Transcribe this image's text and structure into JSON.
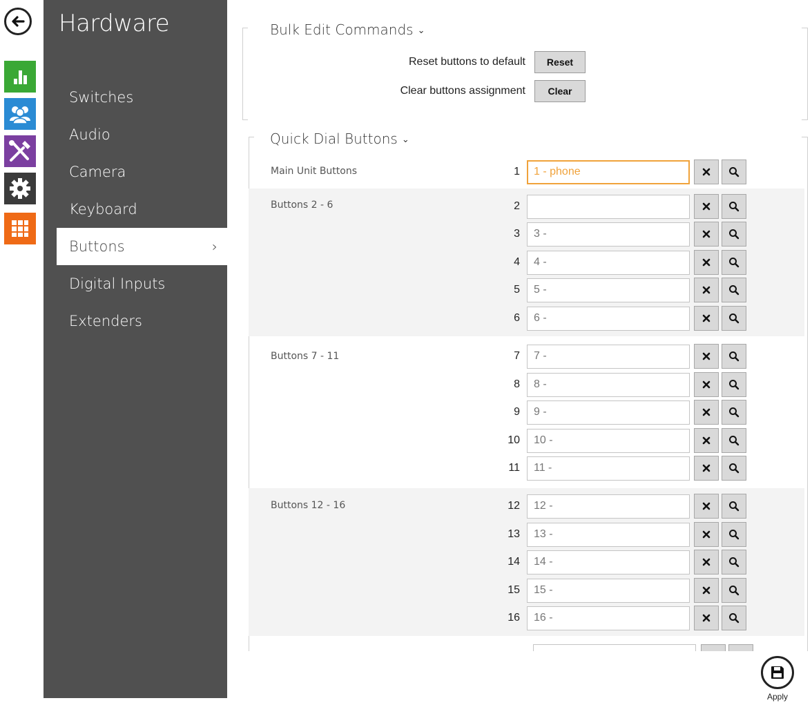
{
  "sidebar": {
    "title": "Hardware",
    "items": [
      {
        "label": "Switches"
      },
      {
        "label": "Audio"
      },
      {
        "label": "Camera"
      },
      {
        "label": "Keyboard"
      },
      {
        "label": "Buttons",
        "chevron": "›"
      },
      {
        "label": "Digital Inputs"
      },
      {
        "label": "Extenders"
      }
    ]
  },
  "rail_icons": [
    {
      "name": "status-icon",
      "color": "#3aa835"
    },
    {
      "name": "directory-icon",
      "color": "#2a8bd4"
    },
    {
      "name": "hardware-icon",
      "color": "#7b3fa0"
    },
    {
      "name": "settings-icon",
      "color": "#3b3b3b"
    },
    {
      "name": "services-icon",
      "color": "#ef6a16"
    }
  ],
  "bulk": {
    "title": "Bulk Edit Commands",
    "caret": "⌄",
    "reset_label": "Reset buttons to default",
    "reset_button": "Reset",
    "clear_label": "Clear buttons assignment",
    "clear_button": "Clear"
  },
  "quick_dial": {
    "title": "Quick Dial Buttons",
    "caret": "⌄",
    "groups": [
      {
        "label": "Main Unit Buttons"
      },
      {
        "label": "Buttons 2 - 6"
      },
      {
        "label": "Buttons 7 - 11"
      },
      {
        "label": "Buttons 12 - 16"
      }
    ],
    "rows": [
      {
        "num": "1",
        "value": "1 - phone"
      },
      {
        "num": "2",
        "value": ""
      },
      {
        "num": "3",
        "value": "3 -"
      },
      {
        "num": "4",
        "value": "4 -"
      },
      {
        "num": "5",
        "value": "5 -"
      },
      {
        "num": "6",
        "value": "6 -"
      },
      {
        "num": "7",
        "value": "7 -"
      },
      {
        "num": "8",
        "value": "8 -"
      },
      {
        "num": "9",
        "value": "9 -"
      },
      {
        "num": "10",
        "value": "10 -"
      },
      {
        "num": "11",
        "value": "11 -"
      },
      {
        "num": "12",
        "value": "12 -"
      },
      {
        "num": "13",
        "value": "13 -"
      },
      {
        "num": "14",
        "value": "14 -"
      },
      {
        "num": "15",
        "value": "15 -"
      },
      {
        "num": "16",
        "value": "16 -"
      }
    ]
  },
  "apply": {
    "label": "Apply"
  },
  "colors": {
    "focus": "#f0a23a",
    "sidebar_bg": "#505050",
    "group_bg": "#f3f3f3"
  }
}
